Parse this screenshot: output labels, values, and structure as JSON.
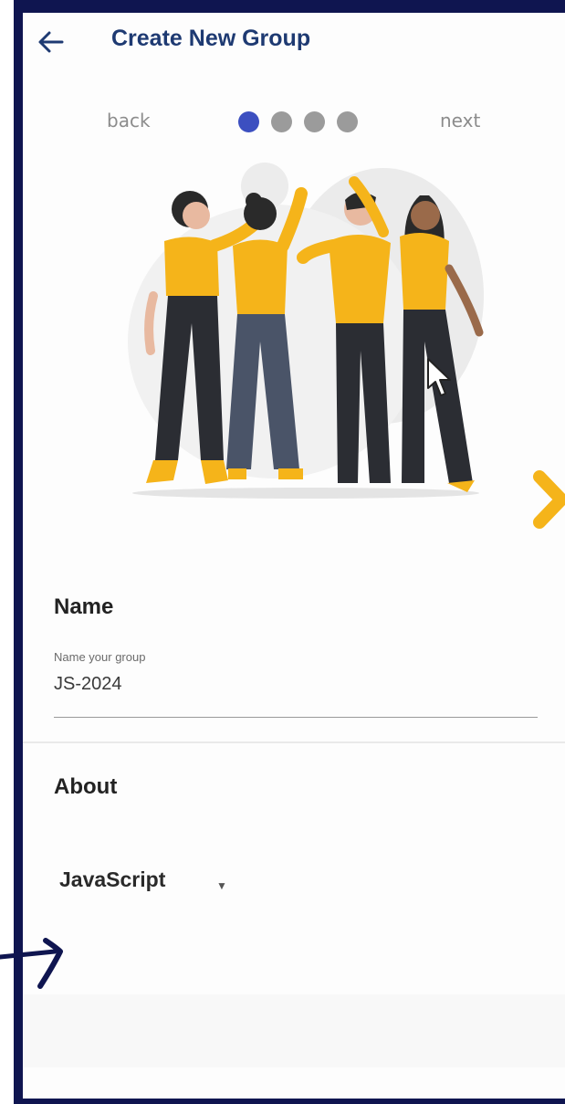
{
  "appbar": {
    "title": "Create New Group",
    "back_icon": "arrow-left-icon"
  },
  "pager": {
    "back_label": "back",
    "next_label": "next",
    "current_step": 1,
    "total_steps": 4
  },
  "name_section": {
    "title": "Name",
    "field_label": "Name your group",
    "field_value": "JS-2024"
  },
  "about_section": {
    "title": "About",
    "selected_option": "JavaScript",
    "caret_icon": "caret-down-icon"
  },
  "colors": {
    "frame": "#0f1550",
    "title": "#1e3a72",
    "active_dot": "#3c4fc0",
    "inactive_dot": "#9b9b9b",
    "accent_yellow": "#f5b41a"
  }
}
